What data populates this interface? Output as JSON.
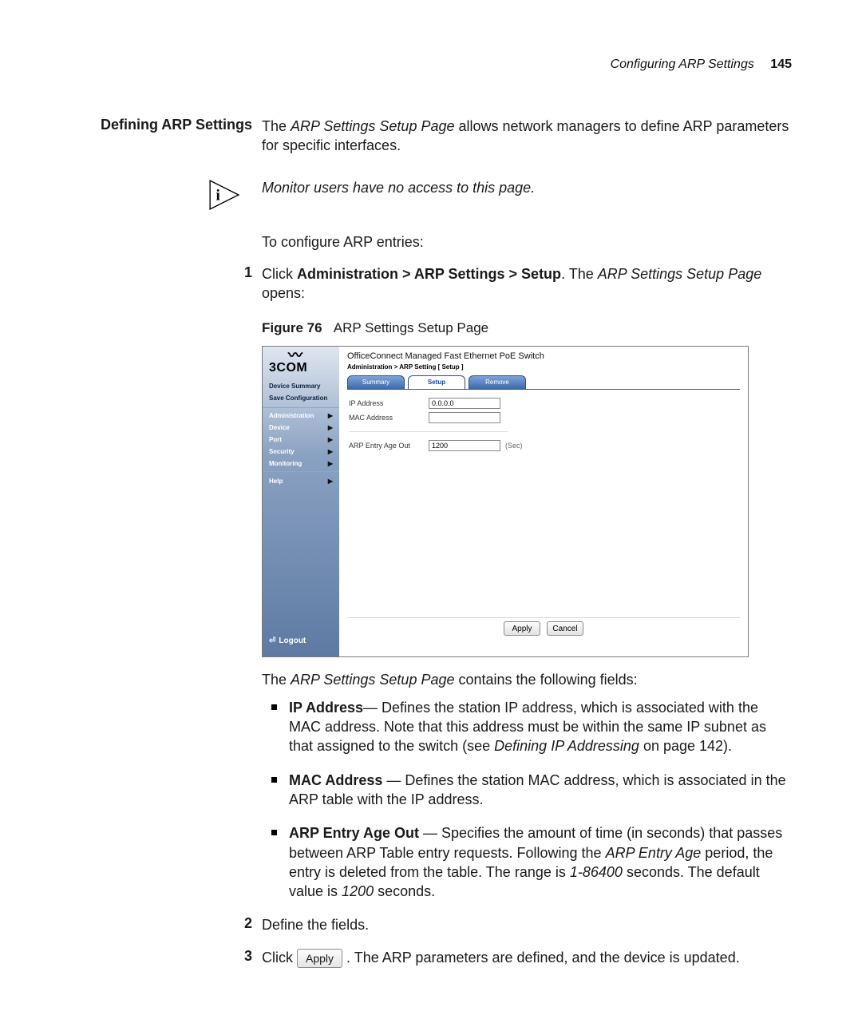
{
  "header": {
    "section_title": "Configuring ARP Settings",
    "page_number": "145"
  },
  "section": {
    "heading": "Defining ARP Settings",
    "intro_1": "The ",
    "intro_em": "ARP Settings Setup Page",
    "intro_2": " allows network managers to define ARP parameters for specific interfaces.",
    "note": "Monitor users have no access to this page.",
    "lead": "To configure ARP entries:"
  },
  "steps": {
    "s1": {
      "num": "1",
      "pre": "Click ",
      "bold": "Administration > ARP Settings > Setup",
      "mid": ". The ",
      "em": "ARP Settings Setup Page",
      "tail": " opens:"
    },
    "s2": {
      "num": "2",
      "text": "Define the fields."
    },
    "s3": {
      "num": "3",
      "pre": "Click ",
      "btn": "Apply",
      "tail": ". The ARP parameters are defined, and the device is updated."
    }
  },
  "figure": {
    "label": "Figure 76",
    "caption": "ARP Settings Setup Page"
  },
  "ui": {
    "brand": "3COM",
    "squiggle": "〰",
    "device_title": "OfficeConnect Managed Fast Ethernet PoE Switch",
    "breadcrumb": "Administration > ARP Setting [ Setup ]",
    "tabs": {
      "summary": "Summary",
      "setup": "Setup",
      "remove": "Remove"
    },
    "form": {
      "ip_label": "IP Address",
      "ip_value": "0.0.0.0",
      "mac_label": "MAC Address",
      "mac_value": "",
      "age_label": "ARP Entry Age Out",
      "age_value": "1200",
      "age_unit": "(Sec)"
    },
    "buttons": {
      "apply": "Apply",
      "cancel": "Cancel"
    },
    "sidebar": {
      "device_summary": "Device Summary",
      "save_config": "Save Configuration",
      "items": [
        {
          "label": "Administration"
        },
        {
          "label": "Device"
        },
        {
          "label": "Port"
        },
        {
          "label": "Security"
        },
        {
          "label": "Monitoring"
        }
      ],
      "help": "Help",
      "logout": "Logout"
    }
  },
  "fields_intro": {
    "pre": "The ",
    "em": "ARP Settings Setup Page",
    "tail": " contains the following fields:"
  },
  "bullets": {
    "ip": {
      "bold": "IP Address",
      "dash": "— Defines the station IP address, which is associated with the MAC address. Note that this address must be within the same IP subnet as that assigned to the switch (see ",
      "em": "Defining IP Addressing",
      "tail": " on page 142)."
    },
    "mac": {
      "bold": "MAC Address",
      "dash": " — Defines the station MAC address, which is associated in the ARP table with the IP address."
    },
    "age": {
      "bold": "ARP Entry Age Out",
      "dash": " — Specifies the amount of time (in seconds) that passes between ARP Table entry requests. Following the ",
      "em": "ARP Entry Age",
      "mid": " period, the entry is deleted from the table. The range is ",
      "em2": "1-86400",
      "mid2": " seconds. The default value is ",
      "em3": "1200",
      "tail": " seconds."
    }
  }
}
